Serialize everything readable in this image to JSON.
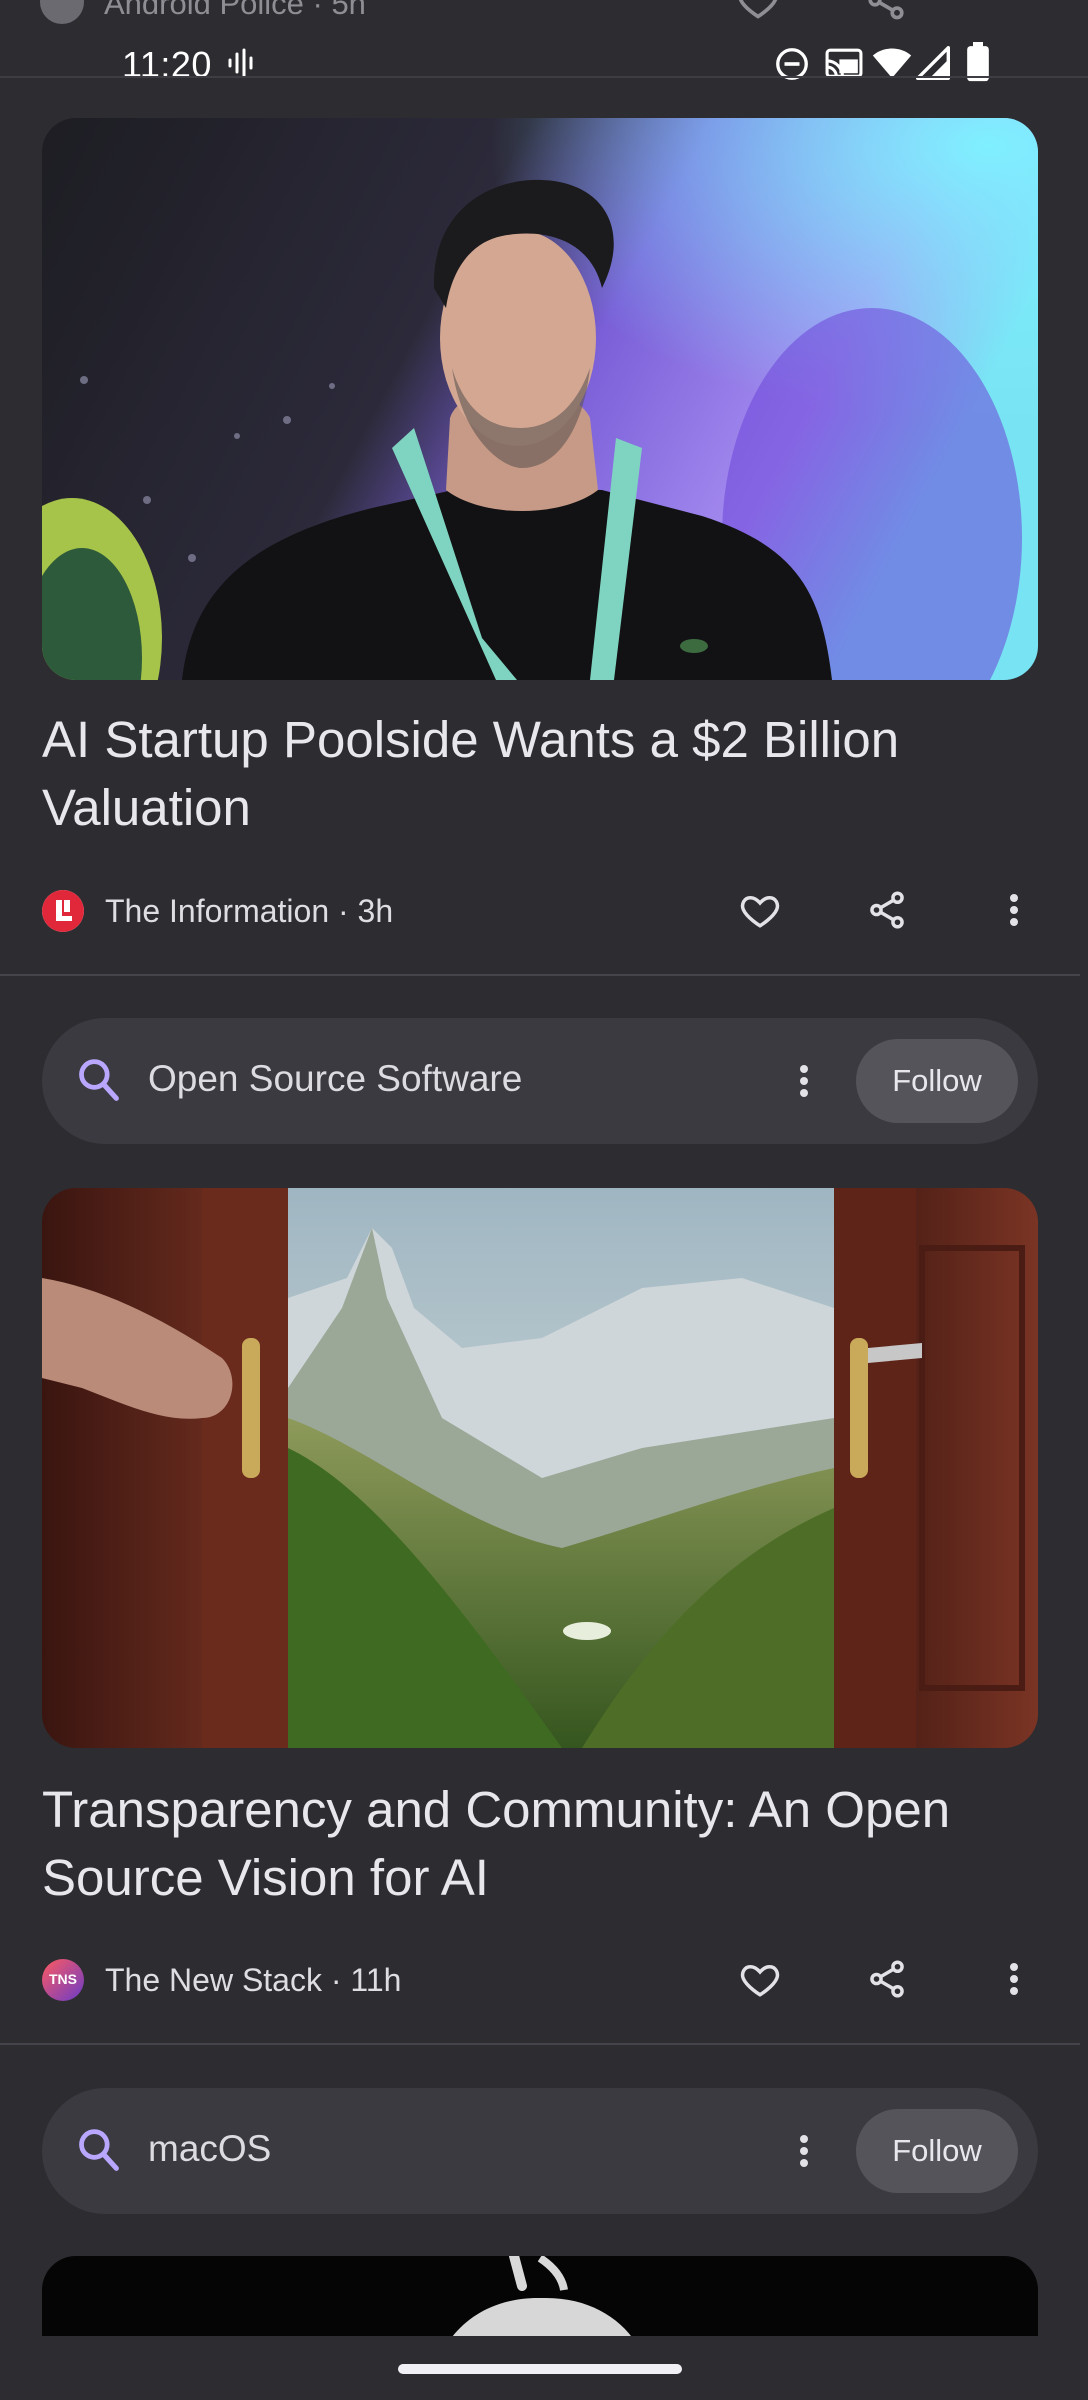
{
  "status_bar": {
    "time": "11:20",
    "icons": [
      "assistant-wave-icon",
      "do-not-disturb-icon",
      "cast-icon",
      "wifi-icon",
      "cellular-signal-icon",
      "battery-icon"
    ]
  },
  "previous_card": {
    "source": "Android Police · 5h"
  },
  "articles": [
    {
      "headline": "AI Startup Poolside Wants a $2 Billion Valuation",
      "source": "The Information · 3h",
      "logo_text": "",
      "logo_color": "#e0283a"
    },
    {
      "headline": "Transparency and Community: An Open Source Vision for AI",
      "source": "The New Stack · 11h",
      "logo_text": "TNS",
      "logo_color": "#8a3ab9"
    }
  ],
  "topics": [
    {
      "label": "Open Source Software",
      "follow_label": "Follow"
    },
    {
      "label": "macOS",
      "follow_label": "Follow"
    }
  ],
  "colors": {
    "background": "#2d2c31",
    "chip": "#3b3a40",
    "search_icon": "#b9a7ff"
  }
}
